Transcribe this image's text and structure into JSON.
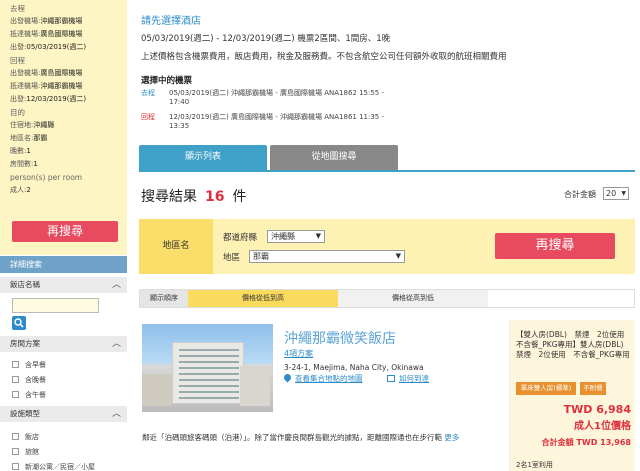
{
  "sidebar": {
    "trip": [
      {
        "label": "去程"
      },
      {
        "label": "出發機場:",
        "value": "沖繩那霸機場"
      },
      {
        "label": "抵達機場:",
        "value": "廣島國際機場"
      },
      {
        "label": "出發:",
        "value": "05/03/2019(週二)"
      },
      {
        "label": "回程"
      },
      {
        "label": "出發機場:",
        "value": "廣島國際機場"
      },
      {
        "label": "抵達機場:",
        "value": "沖繩那霸機場"
      },
      {
        "label": "出發:",
        "value": "12/03/2019(週二)"
      },
      {
        "label": "目的"
      },
      {
        "label": "住宿地:",
        "value": "沖繩縣"
      },
      {
        "label": "地區名:",
        "value": "那霸"
      },
      {
        "label": "晚數:",
        "value": "1"
      },
      {
        "label": "房間數:",
        "value": "1"
      },
      {
        "label": "person(s) per room"
      },
      {
        "label": "成人:",
        "value": "2"
      }
    ],
    "research_button": "再搜尋",
    "detail_header": "詳細搜索",
    "filters": [
      {
        "title": "飯店名稱",
        "options": [],
        "placeholder": ""
      },
      {
        "title": "房間方案",
        "options": [
          "含早餐",
          "含晚餐",
          "含午餐"
        ]
      },
      {
        "title": "設施類型",
        "options": [
          "飯店",
          "旅館",
          "新潮公寓／民宿／小屋"
        ]
      }
    ]
  },
  "main": {
    "select_hotel": "請先選擇酒店",
    "trip_summary": "05/03/2019(週二) - 12/03/2019(週二) 機票2區間、1間房、1晚",
    "notice": "上述價格包含機票費用，飯店費用，稅金及服務費。不包含航空公司任何額外收取的航班相關費用",
    "selected_flights_title": "選擇中的機票",
    "flights": [
      {
        "dir": "去程",
        "line1": "05/03/2019(週二) 沖繩那霸機場 - 廣島國際機場 ANA1862 15:55 -",
        "line2": "17:40"
      },
      {
        "dir": "回程",
        "line1": "12/03/2019(週二) 廣島國際機場 - 沖繩那霸機場 ANA1861 11:35 -",
        "line2": "13:35"
      }
    ],
    "tabs": {
      "list": "顯示列表",
      "map": "從地圖搜尋"
    },
    "results_label": "搜尋結果",
    "results_count": "16",
    "results_unit": "件",
    "total_price_label": "合計金額",
    "per_page": "20",
    "area": {
      "label": "地區名",
      "pref_label": "都道府縣",
      "pref_value": "沖繩縣",
      "region_label": "地區",
      "region_value": "那霸",
      "search_button": "再搜尋"
    },
    "sort": {
      "label": "顯示順序",
      "price_asc": "價格從低到高",
      "price_desc": "價格從高到低"
    },
    "hotel": {
      "name": "沖繩那霸微笑飯店",
      "plans": "4項方案",
      "address": "3-24-1, Maejima, Naha City, Okinawa",
      "map_link": "查看集合地點的地圖",
      "spot_link": "如何到達",
      "description": "鄰近「泊碼頭旅客碼頭（泊港）」。除了當作慶良間群島觀光的據點，距離國際通也在步行範",
      "more": "更多",
      "room_desc": "【雙人房(DBL)　禁煙　2位使用　不含餐_PKG專用】雙人房(DBL)　禁煙　2位使用　不含餐_PKG專用",
      "badge1": "單床雙人房(標準)",
      "badge2": "不附餐",
      "price": "TWD 6,984",
      "per_person": "成人1位價格",
      "total_label": "合計金額",
      "total": "TWD 13,968",
      "availability": "2名1室利用"
    }
  }
}
